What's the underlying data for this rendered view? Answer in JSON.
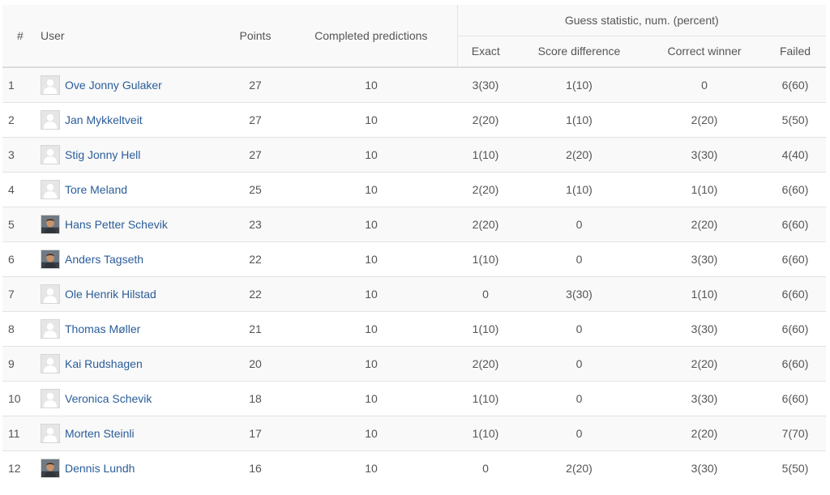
{
  "table": {
    "headers": {
      "rank": "#",
      "user": "User",
      "points": "Points",
      "completed": "Completed predictions",
      "group": "Guess statistic, num. (percent)",
      "exact": "Exact",
      "score_difference": "Score difference",
      "correct_winner": "Correct winner",
      "failed": "Failed"
    },
    "rows": [
      {
        "rank": "1",
        "user": "Ove Jonny Gulaker",
        "avatar": "default-avatar-icon",
        "points": "27",
        "completed": "10",
        "exact": "3(30)",
        "score_difference": "1(10)",
        "correct_winner": "0",
        "failed": "6(60)"
      },
      {
        "rank": "2",
        "user": "Jan Mykkeltveit",
        "avatar": "default-avatar-icon",
        "points": "27",
        "completed": "10",
        "exact": "2(20)",
        "score_difference": "1(10)",
        "correct_winner": "2(20)",
        "failed": "5(50)"
      },
      {
        "rank": "3",
        "user": "Stig Jonny Hell",
        "avatar": "default-avatar-icon",
        "points": "27",
        "completed": "10",
        "exact": "1(10)",
        "score_difference": "2(20)",
        "correct_winner": "3(30)",
        "failed": "4(40)"
      },
      {
        "rank": "4",
        "user": "Tore Meland",
        "avatar": "default-avatar-icon",
        "points": "25",
        "completed": "10",
        "exact": "2(20)",
        "score_difference": "1(10)",
        "correct_winner": "1(10)",
        "failed": "6(60)"
      },
      {
        "rank": "5",
        "user": "Hans Petter Schevik",
        "avatar": "photo-avatar-icon",
        "points": "23",
        "completed": "10",
        "exact": "2(20)",
        "score_difference": "0",
        "correct_winner": "2(20)",
        "failed": "6(60)"
      },
      {
        "rank": "6",
        "user": "Anders Tagseth",
        "avatar": "photo-avatar-icon",
        "points": "22",
        "completed": "10",
        "exact": "1(10)",
        "score_difference": "0",
        "correct_winner": "3(30)",
        "failed": "6(60)"
      },
      {
        "rank": "7",
        "user": "Ole Henrik Hilstad",
        "avatar": "default-avatar-icon",
        "points": "22",
        "completed": "10",
        "exact": "0",
        "score_difference": "3(30)",
        "correct_winner": "1(10)",
        "failed": "6(60)"
      },
      {
        "rank": "8",
        "user": "Thomas Møller",
        "avatar": "default-avatar-icon",
        "points": "21",
        "completed": "10",
        "exact": "1(10)",
        "score_difference": "0",
        "correct_winner": "3(30)",
        "failed": "6(60)"
      },
      {
        "rank": "9",
        "user": "Kai Rudshagen",
        "avatar": "default-avatar-icon",
        "points": "20",
        "completed": "10",
        "exact": "2(20)",
        "score_difference": "0",
        "correct_winner": "2(20)",
        "failed": "6(60)"
      },
      {
        "rank": "10",
        "user": "Veronica Schevik",
        "avatar": "default-avatar-icon",
        "points": "18",
        "completed": "10",
        "exact": "1(10)",
        "score_difference": "0",
        "correct_winner": "3(30)",
        "failed": "6(60)"
      },
      {
        "rank": "11",
        "user": "Morten Steinli",
        "avatar": "default-avatar-icon",
        "points": "17",
        "completed": "10",
        "exact": "1(10)",
        "score_difference": "0",
        "correct_winner": "2(20)",
        "failed": "7(70)"
      },
      {
        "rank": "12",
        "user": "Dennis Lundh",
        "avatar": "photo-avatar-icon",
        "points": "16",
        "completed": "10",
        "exact": "0",
        "score_difference": "2(20)",
        "correct_winner": "3(30)",
        "failed": "5(50)"
      }
    ]
  },
  "colors": {
    "link": "#2b5d99",
    "text": "#555555",
    "stripe": "#f9f9f9",
    "border": "#e3e3e3"
  }
}
